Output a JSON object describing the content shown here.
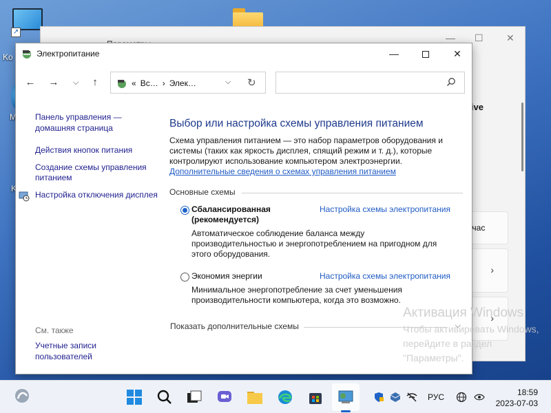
{
  "desktop": {
    "icons": [
      {
        "name": "this-pc-icon",
        "partial_label": "Ko"
      },
      {
        "name": "folder-icon"
      },
      {
        "name": "blue-app-icon",
        "partial_label": "M"
      },
      {
        "name": "unknown-icon",
        "partial_label": "K"
      }
    ]
  },
  "settings_window": {
    "title": "Параметры",
    "partial_heading": "ive",
    "card1_text": "ачас",
    "chevron": "›"
  },
  "main_window": {
    "title": "Электропитание",
    "address": {
      "root_chevrons": "«",
      "crumb1": "Вс…",
      "sep": "›",
      "crumb2": "Элек…"
    },
    "search_placeholder": "",
    "left_pane": {
      "home": "Панель управления — домашняя страница",
      "links": [
        "Действия кнопок питания",
        "Создание схемы управления питанием",
        "Настройка отключения дисплея"
      ],
      "see_also": "См. также",
      "accounts": "Учетные записи пользователей"
    },
    "content": {
      "heading": "Выбор или настройка схемы управления питанием",
      "description": "Схема управления питанием — это набор параметров оборудования и системы (таких как яркость дисплея, спящий режим и т. д.), которые контролируют использование компьютером электроэнергии.",
      "more_info_link": "Дополнительные сведения о схемах управления питанием",
      "section_title": "Основные схемы",
      "plans": [
        {
          "name": "Сбалансированная (рекомендуется)",
          "selected": true,
          "configure_link": "Настройка схемы электропитания",
          "description": "Автоматическое соблюдение баланса между производительностью и энергопотреблением на пригодном для этого оборудования."
        },
        {
          "name": "Экономия энергии",
          "selected": false,
          "configure_link": "Настройка схемы электропитания",
          "description": "Минимальное энергопотребление за счет уменьшения производительности компьютера, когда это возможно."
        }
      ],
      "more_plans": "Показать дополнительные схемы"
    }
  },
  "watermark": {
    "title": "Активация Windows",
    "text": "Чтобы активировать Windows, перейдите в раздел \"Параметры\"."
  },
  "taskbar": {
    "language": "РУС",
    "time": "18:59",
    "date": "2023-07-03",
    "pinned": [
      "widgets-icon",
      "start-icon",
      "search-icon",
      "task-view-icon",
      "chat-icon",
      "file-explorer-icon",
      "edge-icon",
      "store-icon",
      "power-options-icon"
    ],
    "tray": [
      "defender-icon",
      "virtualbox-icon",
      "network-off-icon",
      "globe-icon",
      "accessibility-icon"
    ]
  },
  "colors": {
    "link": "#1f1f8f",
    "heading": "#1e3a8c",
    "accent": "#1f63c8"
  }
}
